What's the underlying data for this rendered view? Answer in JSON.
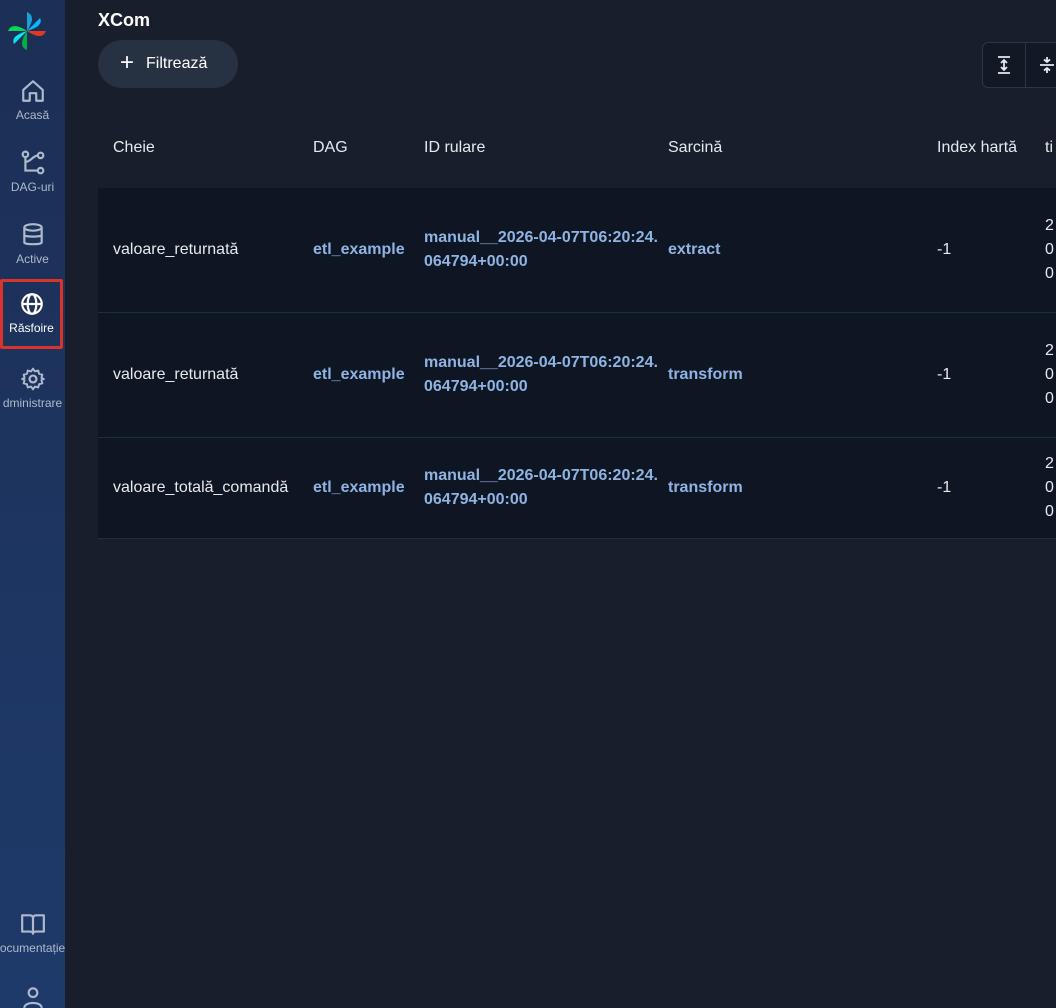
{
  "sidebar": {
    "items": [
      {
        "label": "Acasă",
        "icon": "home-icon"
      },
      {
        "label": "DAG-uri",
        "icon": "dag-icon"
      },
      {
        "label": "Active",
        "icon": "database-icon"
      },
      {
        "label": "Răsfoire",
        "icon": "globe-icon"
      },
      {
        "label": "dministrare",
        "icon": "gear-icon"
      },
      {
        "label": "ocumentație",
        "icon": "book-icon"
      }
    ]
  },
  "page": {
    "title": "XCom",
    "filter_label": "Filtrează"
  },
  "table": {
    "columns": [
      "Cheie",
      "DAG",
      "ID rulare",
      "Sarcină",
      "Index hartă",
      "ti"
    ],
    "rows": [
      {
        "key": "valoare_returnată",
        "dag": "etl_example",
        "run_id": "manual__2026-04-07T06:20:24.064794+00:00",
        "task": "extract",
        "map_index": "-1",
        "ts": "2 0 0"
      },
      {
        "key": "valoare_returnată",
        "dag": "etl_example",
        "run_id": "manual__2026-04-07T06:20:24.064794+00:00",
        "task": "transform",
        "map_index": "-1",
        "ts": "2 0 0"
      },
      {
        "key": "valoare_totală_comandă",
        "dag": "etl_example",
        "run_id": "manual__2026-04-07T06:20:24.064794+00:00",
        "task": "transform",
        "map_index": "-1",
        "ts": "2 0 0"
      }
    ]
  },
  "colors": {
    "background": "#181e2b",
    "sidebar": "#1e3a6a",
    "row_background": "#0f1623",
    "link": "#8fb4e3",
    "active_highlight": "#d9342b"
  }
}
